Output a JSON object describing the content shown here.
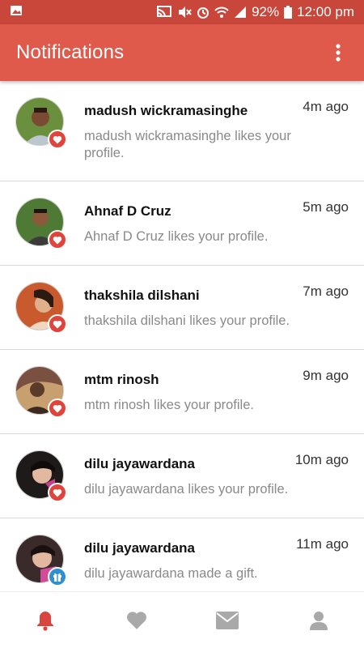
{
  "status_bar": {
    "battery": "92%",
    "time": "12:00 pm",
    "icons": [
      "gallery-icon",
      "cast-icon",
      "mute-icon",
      "alarm-icon",
      "wifi-icon",
      "signal-icon",
      "battery-icon"
    ]
  },
  "app_bar": {
    "title": "Notifications",
    "menu_icon": "more-vert-icon"
  },
  "colors": {
    "status_bar": "#c9463b",
    "app_bar": "#e05a4c",
    "like_badge": "#e0453d",
    "gift_badge": "#2f8fd1",
    "active_tab": "#d9453c",
    "inactive_tab": "#a9a9a9"
  },
  "notifications": [
    {
      "name": "madush wickramasinghe",
      "time": "4m ago",
      "message": "madush wickramasinghe likes your profile.",
      "badge": "heart-icon"
    },
    {
      "name": "Ahnaf D Cruz",
      "time": "5m ago",
      "message": "Ahnaf D Cruz likes your profile.",
      "badge": "heart-icon"
    },
    {
      "name": "thakshila dilshani",
      "time": "7m ago",
      "message": "thakshila dilshani likes your profile.",
      "badge": "heart-icon"
    },
    {
      "name": "mtm rinosh",
      "time": "9m ago",
      "message": "mtm rinosh likes your profile.",
      "badge": "heart-icon"
    },
    {
      "name": "dilu jayawardana",
      "time": "10m ago",
      "message": "dilu jayawardana likes your profile.",
      "badge": "heart-icon"
    },
    {
      "name": "dilu jayawardana",
      "time": "11m ago",
      "message": "dilu jayawardana made a gift.",
      "badge": "gift-icon"
    }
  ],
  "bottom_nav": {
    "items": [
      "bell-icon",
      "heart-icon",
      "mail-icon",
      "person-icon"
    ],
    "active": "bell-icon"
  }
}
